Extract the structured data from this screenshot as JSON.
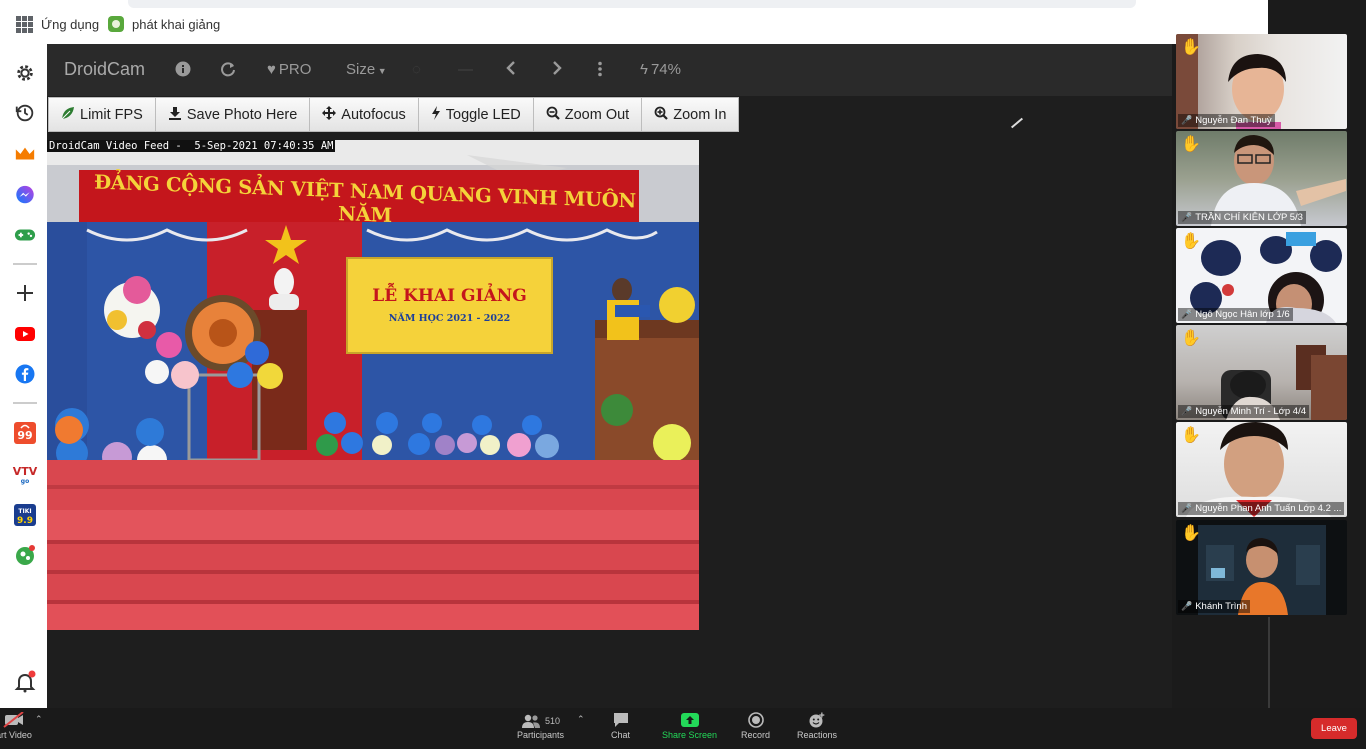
{
  "browser": {
    "bookmarks": [
      {
        "label": "Ứng dụng",
        "icon": "apps-grid-icon"
      },
      {
        "label": "phát khai giảng",
        "icon": "bookmark-favicon-icon"
      }
    ]
  },
  "sidebar": {
    "icons": [
      "settings-icon",
      "history-icon",
      "crown-icon",
      "messenger-icon",
      "gamepad-icon",
      "add-icon",
      "youtube-icon",
      "facebook-icon",
      "shopee-icon",
      "vtv-icon",
      "tiki-icon",
      "soccer-icon",
      "notification-bell-icon"
    ]
  },
  "droidcam": {
    "title": "DroidCam",
    "pro_label": "PRO",
    "size_label": "Size",
    "battery": "74%",
    "toolbar": {
      "limit_fps": "Limit FPS",
      "save_photo": "Save Photo Here",
      "autofocus": "Autofocus",
      "toggle_led": "Toggle LED",
      "zoom_out": "Zoom Out",
      "zoom_in": "Zoom In"
    },
    "feed_label": "DroidCam Video Feed -  5-Sep-2021 07:40:35 AM",
    "banner_top": "ĐẢNG CỘNG SẢN VIỆT NAM QUANG VINH MUÔN NĂM",
    "banner_board_title": "LỄ KHAI GIẢNG",
    "banner_board_year": "NĂM HỌC 2021 - 2022"
  },
  "participants": [
    {
      "name": "Nguyễn Đan Thuỳ",
      "hand": true
    },
    {
      "name": "TRẦN CHÍ KIÊN LỚP 5/3",
      "hand": true
    },
    {
      "name": "Ngô Ngọc Hân lớp 1/6",
      "hand": true
    },
    {
      "name": "Nguyễn Minh Trí  - Lớp 4/4",
      "hand": true
    },
    {
      "name": "Nguyễn Phan Anh Tuấn Lớp 4.2 ...",
      "hand": true
    },
    {
      "name": "Khánh Trình",
      "hand": true
    }
  ],
  "meeting_bar": {
    "video_label": "art Video",
    "participants_label": "Participants",
    "participants_count": "510",
    "chat_label": "Chat",
    "share_label": "Share Screen",
    "record_label": "Record",
    "reactions_label": "Reactions",
    "leave_label": "Leave",
    "share_color": "#23d959",
    "leave_color": "#d62b2b"
  }
}
